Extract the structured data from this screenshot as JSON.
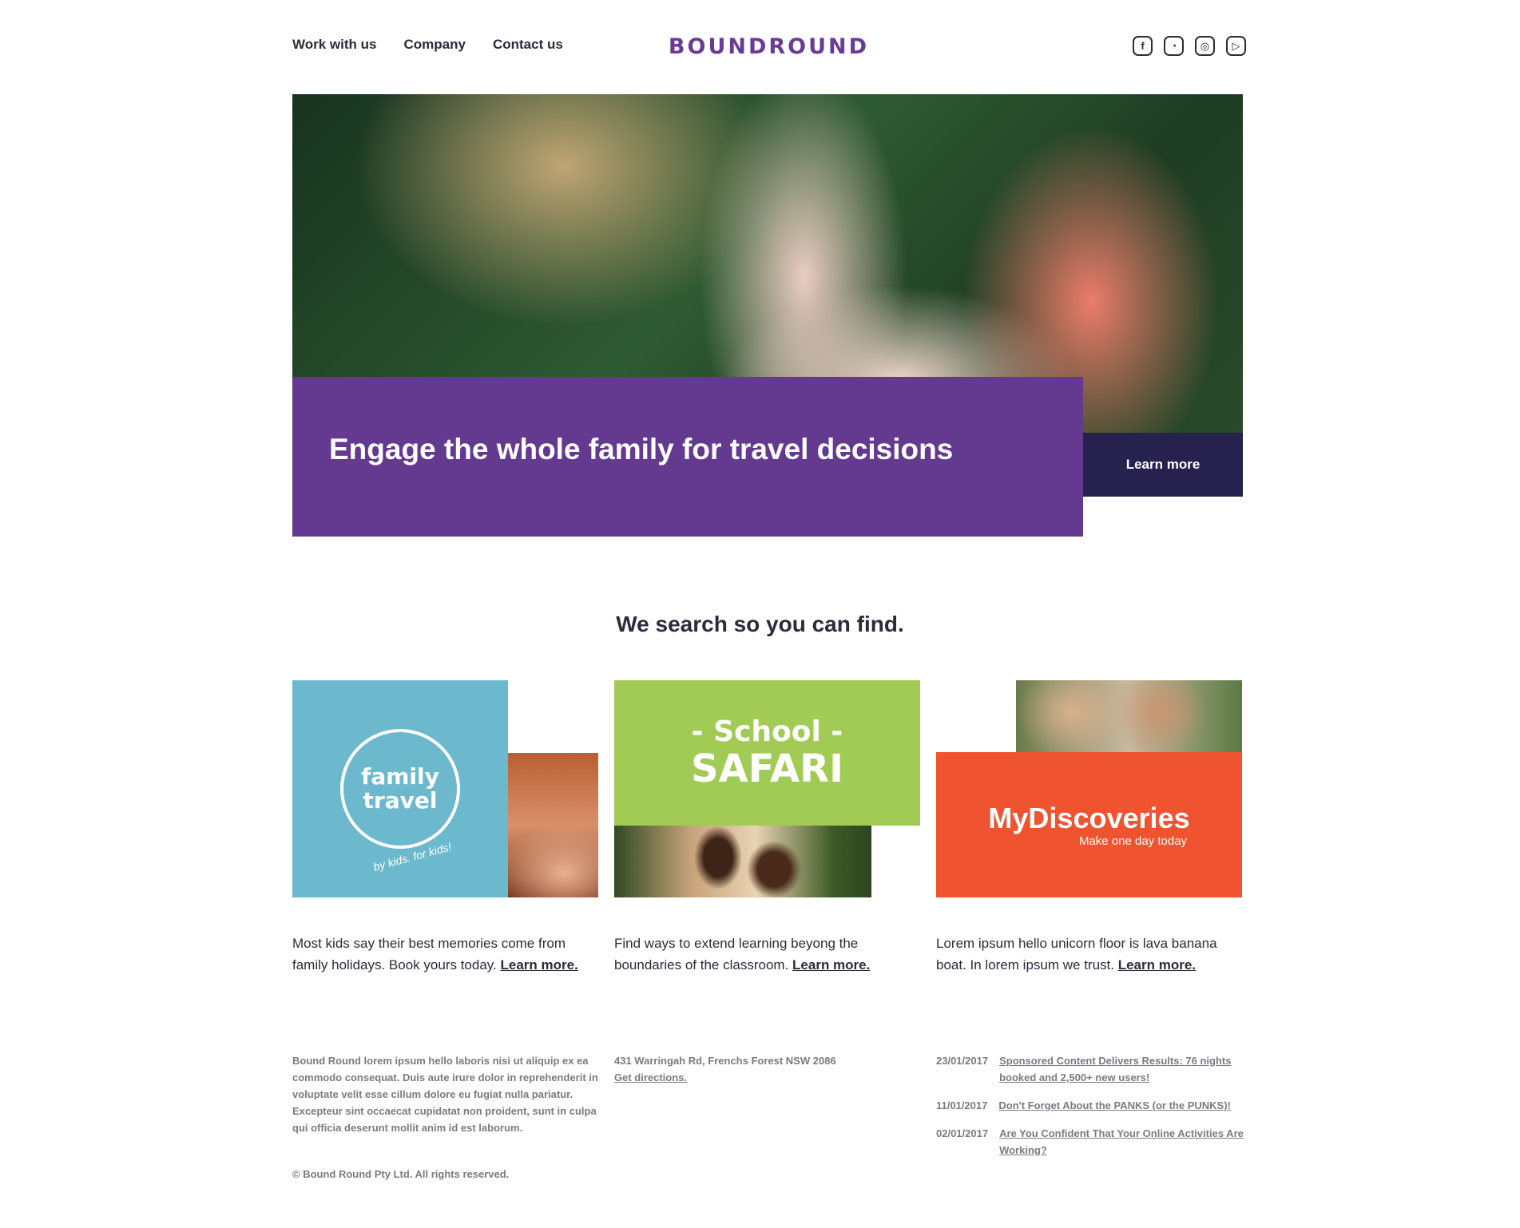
{
  "nav": {
    "items": [
      "Work with us",
      "Company",
      "Contact us"
    ]
  },
  "logo": {
    "text": "BOUNDROUND",
    "color": "#6a3b96"
  },
  "social": [
    {
      "icon": "facebook-icon",
      "glyph": "f"
    },
    {
      "icon": "chat-icon",
      "glyph": "◔"
    },
    {
      "icon": "instagram-icon",
      "glyph": "◎"
    },
    {
      "icon": "youtube-icon",
      "glyph": "▷"
    }
  ],
  "hero": {
    "title": "Engage the whole family for travel decisions",
    "cta": "Learn more",
    "banner_color": "#643a90",
    "cta_color": "#26214f"
  },
  "section_title": "We search so you can find.",
  "cards": [
    {
      "brand_line1": "family",
      "brand_line2": "travel",
      "brand_sub": "by kids. for kids!",
      "text": "Most kids say their best memories come from family holidays. Book yours today.",
      "link": "Learn more.",
      "color": "#6cb9cd"
    },
    {
      "brand_line1": "- School -",
      "brand_line2": "SAFARI",
      "text": "Find ways to extend learning beyong the boundaries of the classroom.",
      "link": "Learn more.",
      "color": "#a2cb56"
    },
    {
      "brand_line1": "MyDiscoveries",
      "brand_line2": "Make one day today",
      "text": "Lorem ipsum hello unicorn floor is lava banana boat. In lorem ipsum we trust.",
      "link": "Learn more.",
      "color": "#f0532f"
    }
  ],
  "footer": {
    "about": "Bound Round lorem ipsum hello laboris nisi ut aliquip ex ea commodo consequat. Duis aute irure dolor in reprehenderit in voluptate velit esse cillum dolore eu fugiat nulla pariatur. Excepteur sint occaecat cupidatat non proident, sunt in culpa qui officia deserunt mollit anim id est laborum.",
    "address": "431 Warringah Rd, Frenchs Forest NSW 2086",
    "directions": "Get directions.",
    "news": [
      {
        "date": "23/01/2017",
        "title": "Sponsored Content Delivers Results: 76 nights booked and 2,500+ new users!"
      },
      {
        "date": "11/01/2017",
        "title": "Don't Forget About the PANKS (or the PUNKS)!"
      },
      {
        "date": "02/01/2017",
        "title": "Are You Confident That Your Online Activities Are Working?"
      }
    ],
    "copyright": "© Bound Round Pty Ltd. All rights reserved."
  }
}
